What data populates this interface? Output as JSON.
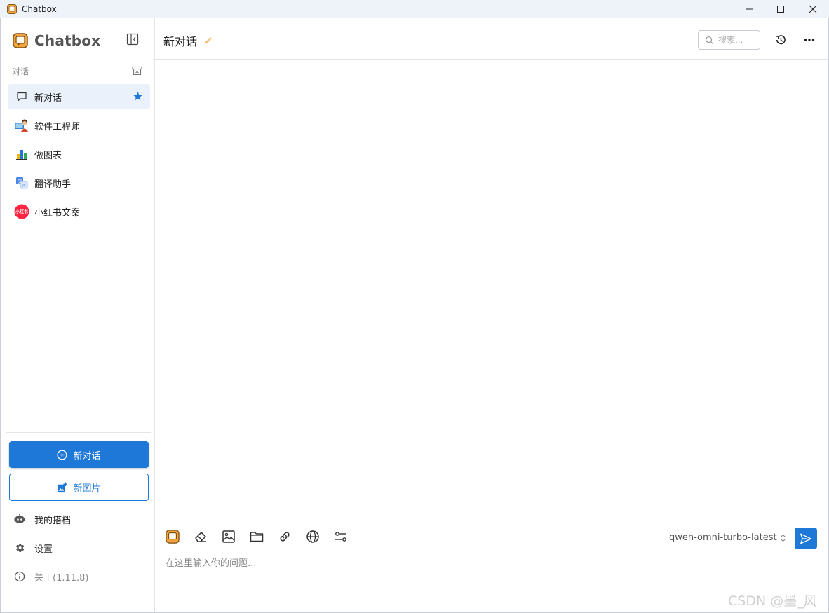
{
  "window": {
    "title": "Chatbox"
  },
  "sidebar": {
    "brand": "Chatbox",
    "section_label": "对话",
    "conversations": [
      {
        "label": "新对话",
        "icon": "chat-bubble-icon",
        "active": true,
        "starred": true
      },
      {
        "label": "软件工程师",
        "icon": "developer-avatar-icon"
      },
      {
        "label": "做图表",
        "icon": "bar-chart-icon"
      },
      {
        "label": "翻译助手",
        "icon": "translate-icon"
      },
      {
        "label": "小红书文案",
        "icon": "xiaohongshu-icon",
        "badge": "小红书"
      }
    ],
    "new_chat_label": "新对话",
    "new_image_label": "新图片",
    "nav": {
      "copilots": "我的搭档",
      "settings": "设置",
      "about": "关于(1.11.8)"
    }
  },
  "header": {
    "title": "新对话",
    "search_placeholder": "搜索..."
  },
  "composer": {
    "model": "qwen-omni-turbo-latest",
    "placeholder": "在这里输入你的问题..."
  },
  "watermark": "CSDN @墨_风",
  "colors": {
    "accent": "#1e78d7",
    "active_bg": "#eaf1fb",
    "badge_red": "#ff2442"
  }
}
